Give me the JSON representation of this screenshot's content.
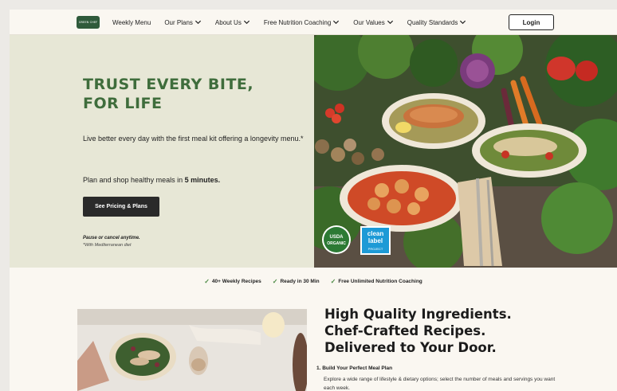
{
  "nav": {
    "logo_text": "GREEN CHEF",
    "items": [
      {
        "label": "Weekly Menu",
        "dropdown": false
      },
      {
        "label": "Our Plans",
        "dropdown": true
      },
      {
        "label": "About Us",
        "dropdown": true
      },
      {
        "label": "Free Nutrition Coaching",
        "dropdown": true
      },
      {
        "label": "Our Values",
        "dropdown": true
      },
      {
        "label": "Quality Standards",
        "dropdown": true
      }
    ],
    "login_label": "Login"
  },
  "hero": {
    "title": "TRUST EVERY BITE,\nFOR LIFE",
    "subtitle": "Live better every day with the first meal kit offering a longevity menu.*",
    "plan_prefix": "Plan and shop healthy meals in ",
    "plan_bold": "5 minutes.",
    "cta_label": "See Pricing & Plans",
    "fine_print_1": "Pause or cancel anytime.",
    "fine_print_2": "*With Mediterranean diet",
    "usda_badge_line1": "USDA",
    "usda_badge_line2": "ORGANIC",
    "clean_label_line1": "clean",
    "clean_label_line2": "label",
    "clean_label_line3": "PROJECT"
  },
  "badges": [
    "40+ Weekly Recipes",
    "Ready in 30 Min",
    "Free Unlimited Nutrition Coaching"
  ],
  "features": {
    "title": "High Quality Ingredients.\nChef-Crafted Recipes.\nDelivered to Your Door.",
    "step1_title": "1. Build Your Perfect Meal Plan",
    "step1_desc": "Explore a wide range of lifestyle & dietary options; select the number of meals and servings you want each week."
  },
  "colors": {
    "brand_green": "#3f6d3c",
    "hero_bg": "#e7e7d6",
    "cta_bg": "#2a2a2a",
    "page_bg": "#faf7f1"
  }
}
